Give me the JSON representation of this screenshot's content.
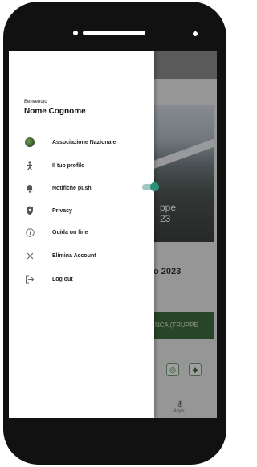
{
  "drawer": {
    "greeting": "Benvenuto",
    "user_name": "Nome Cognome",
    "items": [
      {
        "label": "Associazione Nazionale",
        "icon": "association-logo-icon"
      },
      {
        "label": "Il tuo profilo",
        "icon": "person-icon"
      },
      {
        "label": "Notifiche push",
        "icon": "bell-icon",
        "toggle_on": true
      },
      {
        "label": "Privacy",
        "icon": "shield-icon"
      },
      {
        "label": "Guida on line",
        "icon": "info-icon"
      },
      {
        "label": "Elimina Account",
        "icon": "close-icon"
      },
      {
        "label": "Log out",
        "icon": "logout-icon"
      }
    ]
  },
  "background_app": {
    "photo_text_line1": "ppe",
    "photo_text_line2": "23",
    "year_text": "o 2023",
    "green_button_label": "NCA (TRUPPE",
    "bottom_nav_label": "Apps"
  },
  "colors": {
    "toggle_track": "#9fc9bf",
    "toggle_knob": "#2f8f78",
    "brand_green": "#3f6a3f"
  }
}
